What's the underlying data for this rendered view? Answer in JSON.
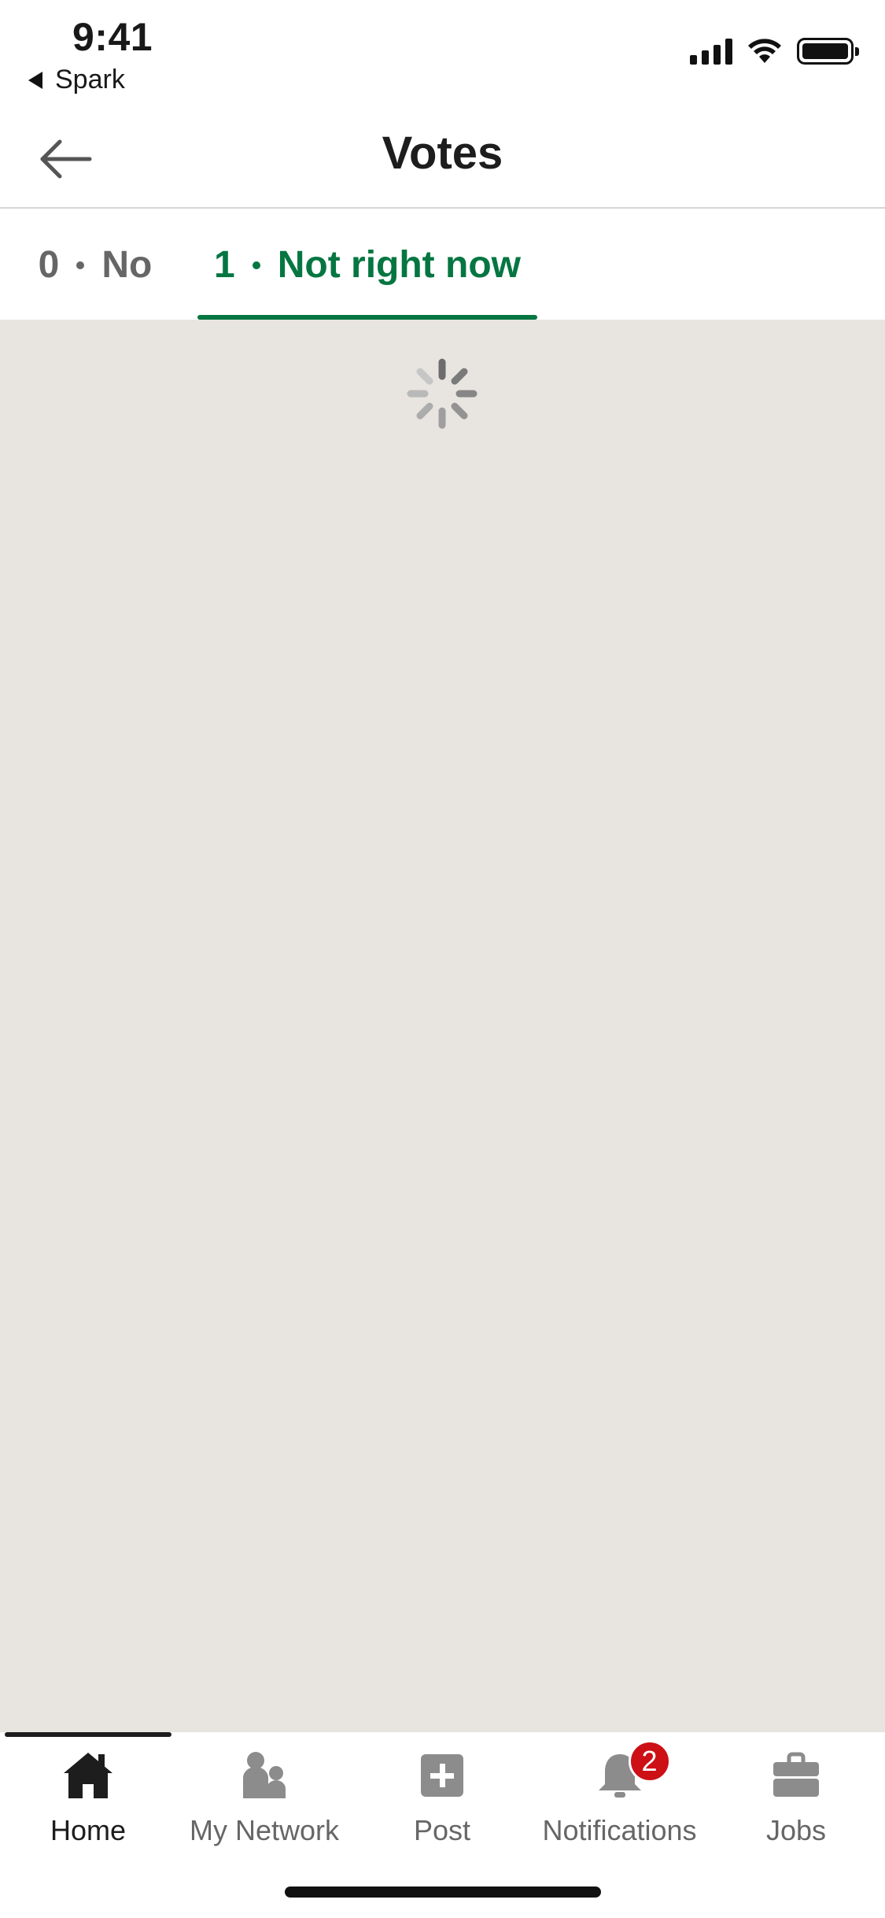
{
  "status_bar": {
    "time": "9:41",
    "back_app": "Spark"
  },
  "header": {
    "title": "Votes",
    "back_icon": "arrow-left-icon"
  },
  "tabs": [
    {
      "count": "0",
      "label": "No",
      "selected": false
    },
    {
      "count": "1",
      "label": "Not right now",
      "selected": true
    }
  ],
  "content": {
    "loading": true
  },
  "bottom_nav": {
    "items": [
      {
        "label": "Home",
        "icon": "home-icon",
        "active": true
      },
      {
        "label": "My Network",
        "icon": "network-icon",
        "active": false
      },
      {
        "label": "Post",
        "icon": "post-icon",
        "active": false
      },
      {
        "label": "Notifications",
        "icon": "bell-icon",
        "active": false,
        "badge": "2"
      },
      {
        "label": "Jobs",
        "icon": "briefcase-icon",
        "active": false
      }
    ]
  },
  "colors": {
    "accent": "#057642",
    "content_bg": "#e8e4df",
    "badge": "#cc1016",
    "inactive_text": "#666666"
  }
}
